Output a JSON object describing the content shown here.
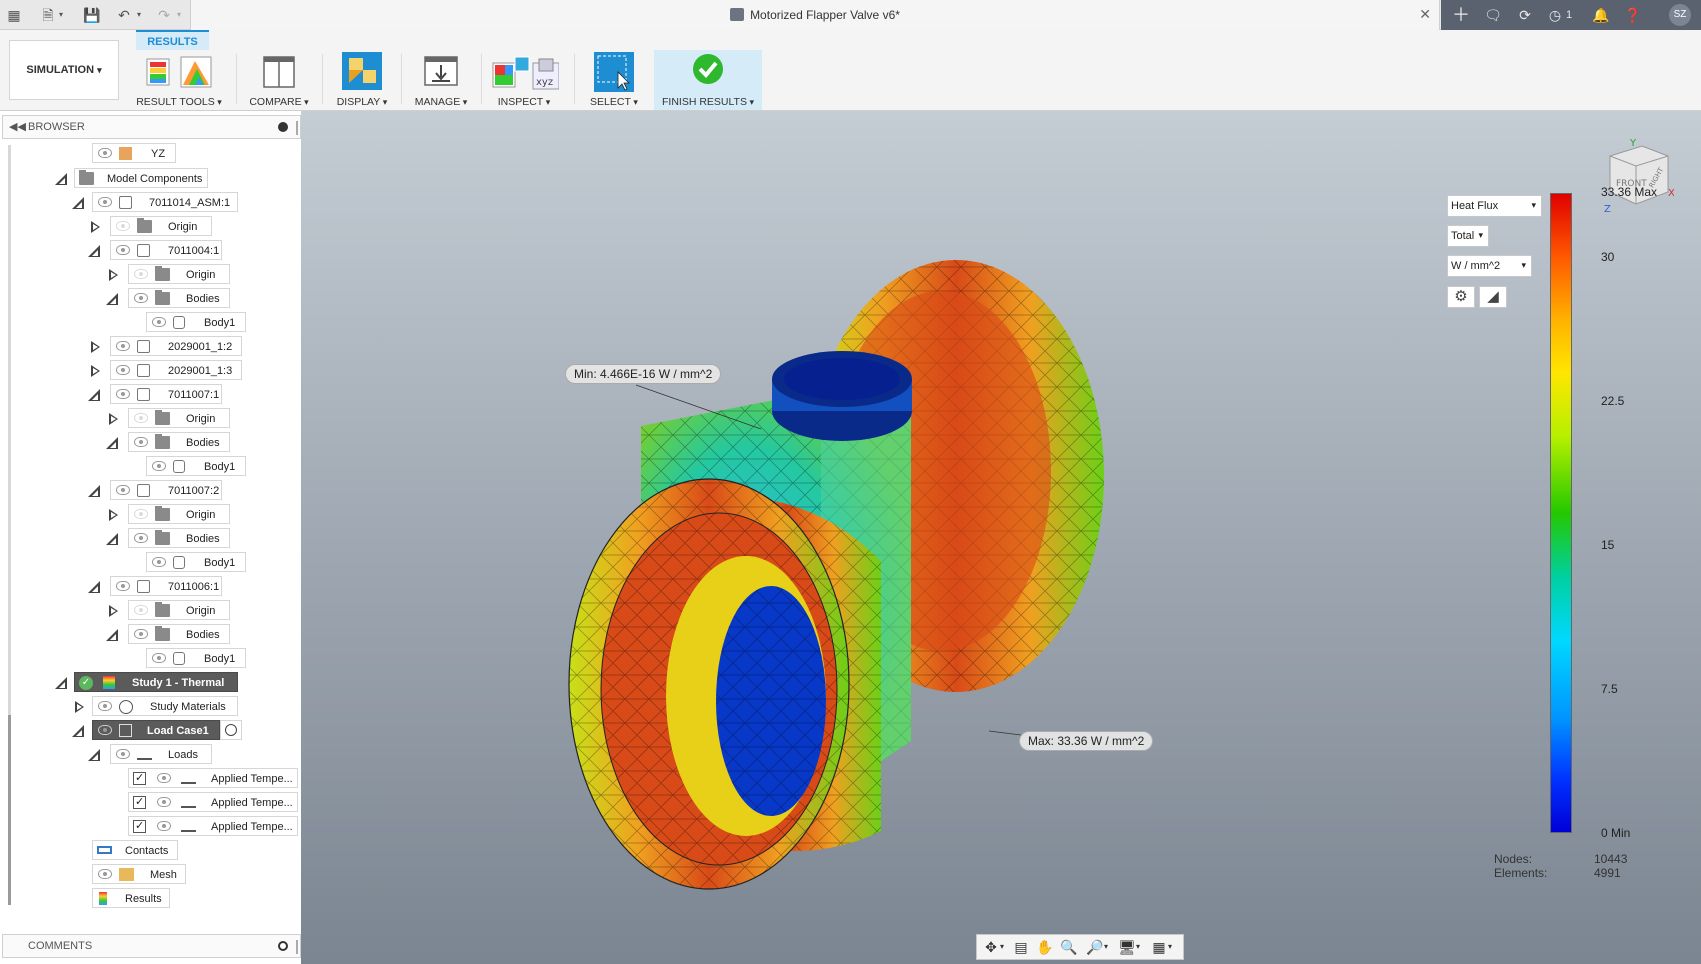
{
  "titlebar": {
    "doc_title": "Motorized Flapper Valve v6*",
    "job_count": "1",
    "user_initials": "SZ"
  },
  "toolbar": {
    "workspace": "SIMULATION",
    "tab": "RESULTS",
    "groups": {
      "result_tools": "RESULT TOOLS",
      "compare": "COMPARE",
      "display": "DISPLAY",
      "manage": "MANAGE",
      "inspect": "INSPECT",
      "select": "SELECT",
      "finish": "FINISH RESULTS"
    }
  },
  "browser": {
    "title": "BROWSER",
    "items": [
      {
        "label": "YZ"
      },
      {
        "label": "Model Components"
      },
      {
        "label": "7011014_ASM:1"
      },
      {
        "label": "Origin"
      },
      {
        "label": "7011004:1"
      },
      {
        "label": "Origin"
      },
      {
        "label": "Bodies"
      },
      {
        "label": "Body1"
      },
      {
        "label": "2029001_1:2"
      },
      {
        "label": "2029001_1:3"
      },
      {
        "label": "7011007:1"
      },
      {
        "label": "Origin"
      },
      {
        "label": "Bodies"
      },
      {
        "label": "Body1"
      },
      {
        "label": "7011007:2"
      },
      {
        "label": "Origin"
      },
      {
        "label": "Bodies"
      },
      {
        "label": "Body1"
      },
      {
        "label": "7011006:1"
      },
      {
        "label": "Origin"
      },
      {
        "label": "Bodies"
      },
      {
        "label": "Body1"
      },
      {
        "label": "Study 1 - Thermal"
      },
      {
        "label": "Study Materials"
      },
      {
        "label": "Load Case1"
      },
      {
        "label": "Loads"
      },
      {
        "label": "Applied Tempe..."
      },
      {
        "label": "Applied Tempe..."
      },
      {
        "label": "Applied Tempe..."
      },
      {
        "label": "Contacts"
      },
      {
        "label": "Mesh"
      },
      {
        "label": "Results"
      }
    ]
  },
  "comments": {
    "title": "COMMENTS"
  },
  "legend": {
    "result_type": "Heat Flux",
    "component": "Total",
    "units": "W / mm^2",
    "max_label": "33.36 Max",
    "min_label": "0 Min",
    "ticks": [
      "30",
      "22.5",
      "15",
      "7.5"
    ],
    "range": [
      0,
      33.36
    ]
  },
  "callouts": {
    "min": "Min: 4.466E-16 W / mm^2",
    "max": "Max: 33.36 W / mm^2"
  },
  "stats": {
    "nodes_label": "Nodes:",
    "nodes_value": "10443",
    "elements_label": "Elements:",
    "elements_value": "4991"
  },
  "viewcube": {
    "face": "FRONT",
    "side": "RIGHT",
    "axis_x": "X",
    "axis_y": "Y",
    "axis_z": "Z"
  }
}
